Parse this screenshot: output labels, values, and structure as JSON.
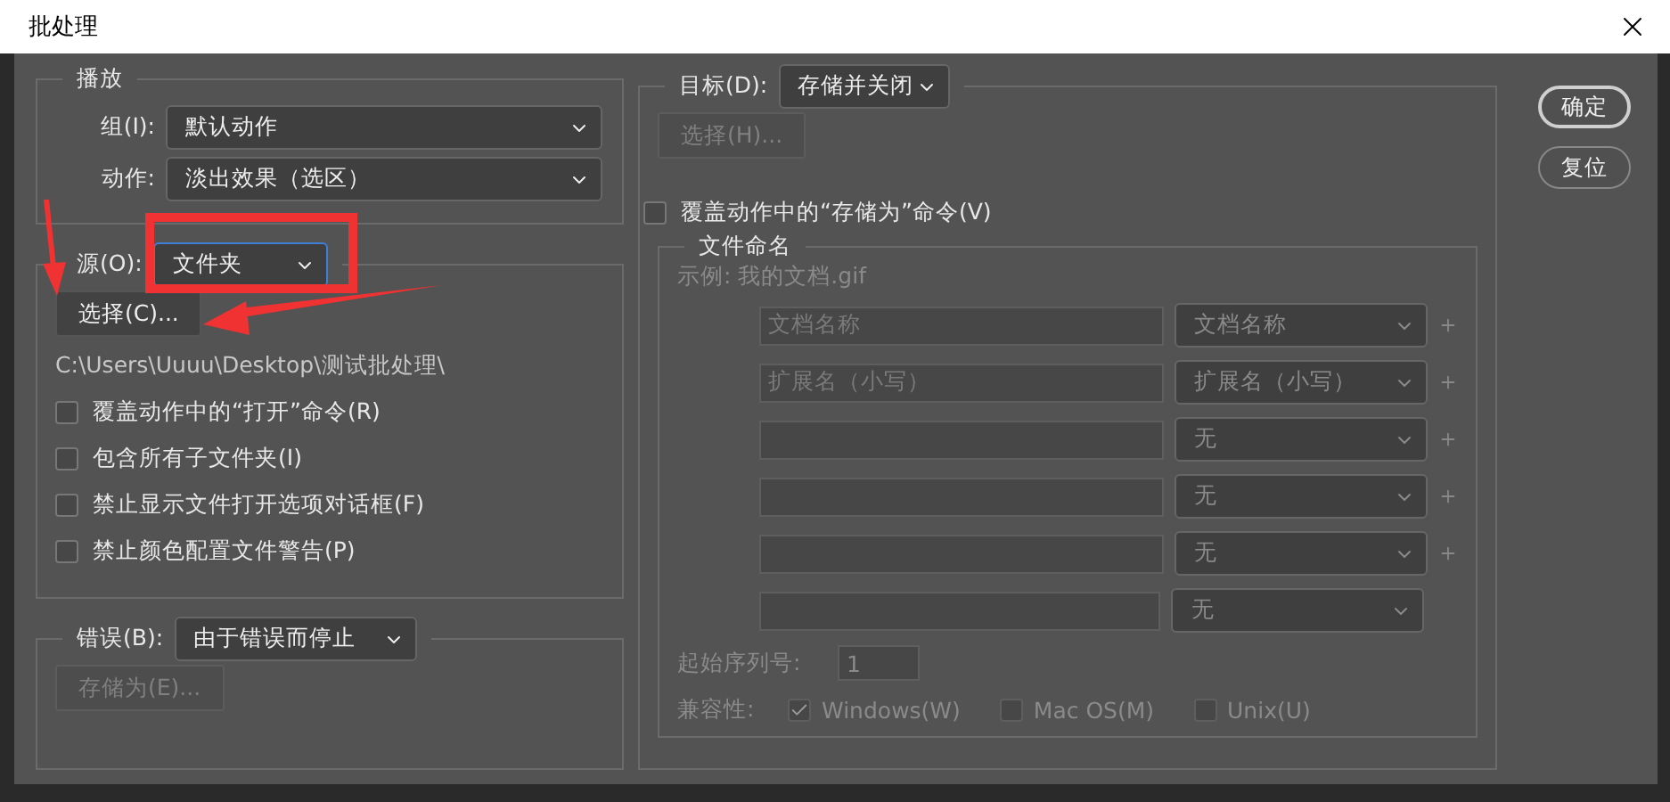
{
  "window": {
    "title": "批处理"
  },
  "play": {
    "legend": "播放",
    "fields": [
      {
        "label": "组(I):",
        "value": "默认动作"
      },
      {
        "label": "动作:",
        "value": "淡出效果（选区）"
      }
    ]
  },
  "source": {
    "label": "源(O):",
    "value": "文件夹",
    "focused": true,
    "choose_button": "选择(C)...",
    "path": "C:\\Users\\Uuuu\\Desktop\\测试批处理\\",
    "options": [
      {
        "label": "覆盖动作中的“打开”命令(R)",
        "checked": false
      },
      {
        "label": "包含所有子文件夹(I)",
        "checked": false
      },
      {
        "label": "禁止显示文件打开选项对话框(F)",
        "checked": false
      },
      {
        "label": "禁止颜色配置文件警告(P)",
        "checked": false
      }
    ]
  },
  "error": {
    "label": "错误(B):",
    "value": "由于错误而停止",
    "save_as_button": {
      "label": "存储为(E)...",
      "disabled": true
    }
  },
  "destination": {
    "label": "目标(D):",
    "value": "存储并关闭",
    "choose_button": {
      "label": "选择(H)...",
      "disabled": true
    },
    "override": {
      "label": "覆盖动作中的“存储为”命令(V)",
      "checked": false
    },
    "file_naming": {
      "legend": "文件命名",
      "disabled": true,
      "example": "示例: 我的文档.gif",
      "rows": [
        {
          "text": "文档名称",
          "menu": "文档名称",
          "plus": true
        },
        {
          "text": "扩展名（小写）",
          "menu": "扩展名（小写）",
          "plus": true
        },
        {
          "menu": "无",
          "plus": true
        },
        {
          "menu": "无",
          "plus": true
        },
        {
          "menu": "无",
          "plus": true
        },
        {
          "menu": "无",
          "plus": false
        }
      ],
      "serial": {
        "label": "起始序列号:",
        "value": "1"
      },
      "compat": {
        "label": "兼容性:",
        "options": [
          {
            "label": "Windows(W)",
            "checked": true
          },
          {
            "label": "Mac OS(M)",
            "checked": false
          },
          {
            "label": "Unix(U)",
            "checked": false
          }
        ]
      }
    }
  },
  "buttons": [
    {
      "label": "确定",
      "default": true
    },
    {
      "label": "复位",
      "default": false
    }
  ]
}
